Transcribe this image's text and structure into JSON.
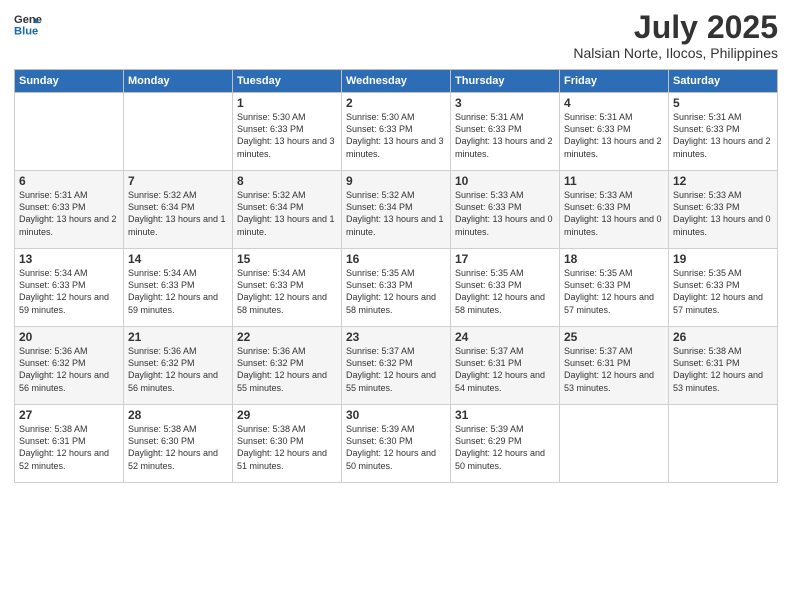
{
  "header": {
    "logo_line1": "General",
    "logo_line2": "Blue",
    "month": "July 2025",
    "location": "Nalsian Norte, Ilocos, Philippines"
  },
  "weekdays": [
    "Sunday",
    "Monday",
    "Tuesday",
    "Wednesday",
    "Thursday",
    "Friday",
    "Saturday"
  ],
  "weeks": [
    [
      {
        "day": "",
        "info": ""
      },
      {
        "day": "",
        "info": ""
      },
      {
        "day": "1",
        "info": "Sunrise: 5:30 AM\nSunset: 6:33 PM\nDaylight: 13 hours\nand 3 minutes."
      },
      {
        "day": "2",
        "info": "Sunrise: 5:30 AM\nSunset: 6:33 PM\nDaylight: 13 hours\nand 3 minutes."
      },
      {
        "day": "3",
        "info": "Sunrise: 5:31 AM\nSunset: 6:33 PM\nDaylight: 13 hours\nand 2 minutes."
      },
      {
        "day": "4",
        "info": "Sunrise: 5:31 AM\nSunset: 6:33 PM\nDaylight: 13 hours\nand 2 minutes."
      },
      {
        "day": "5",
        "info": "Sunrise: 5:31 AM\nSunset: 6:33 PM\nDaylight: 13 hours\nand 2 minutes."
      }
    ],
    [
      {
        "day": "6",
        "info": "Sunrise: 5:31 AM\nSunset: 6:33 PM\nDaylight: 13 hours\nand 2 minutes."
      },
      {
        "day": "7",
        "info": "Sunrise: 5:32 AM\nSunset: 6:34 PM\nDaylight: 13 hours\nand 1 minute."
      },
      {
        "day": "8",
        "info": "Sunrise: 5:32 AM\nSunset: 6:34 PM\nDaylight: 13 hours\nand 1 minute."
      },
      {
        "day": "9",
        "info": "Sunrise: 5:32 AM\nSunset: 6:34 PM\nDaylight: 13 hours\nand 1 minute."
      },
      {
        "day": "10",
        "info": "Sunrise: 5:33 AM\nSunset: 6:33 PM\nDaylight: 13 hours\nand 0 minutes."
      },
      {
        "day": "11",
        "info": "Sunrise: 5:33 AM\nSunset: 6:33 PM\nDaylight: 13 hours\nand 0 minutes."
      },
      {
        "day": "12",
        "info": "Sunrise: 5:33 AM\nSunset: 6:33 PM\nDaylight: 13 hours\nand 0 minutes."
      }
    ],
    [
      {
        "day": "13",
        "info": "Sunrise: 5:34 AM\nSunset: 6:33 PM\nDaylight: 12 hours\nand 59 minutes."
      },
      {
        "day": "14",
        "info": "Sunrise: 5:34 AM\nSunset: 6:33 PM\nDaylight: 12 hours\nand 59 minutes."
      },
      {
        "day": "15",
        "info": "Sunrise: 5:34 AM\nSunset: 6:33 PM\nDaylight: 12 hours\nand 58 minutes."
      },
      {
        "day": "16",
        "info": "Sunrise: 5:35 AM\nSunset: 6:33 PM\nDaylight: 12 hours\nand 58 minutes."
      },
      {
        "day": "17",
        "info": "Sunrise: 5:35 AM\nSunset: 6:33 PM\nDaylight: 12 hours\nand 58 minutes."
      },
      {
        "day": "18",
        "info": "Sunrise: 5:35 AM\nSunset: 6:33 PM\nDaylight: 12 hours\nand 57 minutes."
      },
      {
        "day": "19",
        "info": "Sunrise: 5:35 AM\nSunset: 6:33 PM\nDaylight: 12 hours\nand 57 minutes."
      }
    ],
    [
      {
        "day": "20",
        "info": "Sunrise: 5:36 AM\nSunset: 6:32 PM\nDaylight: 12 hours\nand 56 minutes."
      },
      {
        "day": "21",
        "info": "Sunrise: 5:36 AM\nSunset: 6:32 PM\nDaylight: 12 hours\nand 56 minutes."
      },
      {
        "day": "22",
        "info": "Sunrise: 5:36 AM\nSunset: 6:32 PM\nDaylight: 12 hours\nand 55 minutes."
      },
      {
        "day": "23",
        "info": "Sunrise: 5:37 AM\nSunset: 6:32 PM\nDaylight: 12 hours\nand 55 minutes."
      },
      {
        "day": "24",
        "info": "Sunrise: 5:37 AM\nSunset: 6:31 PM\nDaylight: 12 hours\nand 54 minutes."
      },
      {
        "day": "25",
        "info": "Sunrise: 5:37 AM\nSunset: 6:31 PM\nDaylight: 12 hours\nand 53 minutes."
      },
      {
        "day": "26",
        "info": "Sunrise: 5:38 AM\nSunset: 6:31 PM\nDaylight: 12 hours\nand 53 minutes."
      }
    ],
    [
      {
        "day": "27",
        "info": "Sunrise: 5:38 AM\nSunset: 6:31 PM\nDaylight: 12 hours\nand 52 minutes."
      },
      {
        "day": "28",
        "info": "Sunrise: 5:38 AM\nSunset: 6:30 PM\nDaylight: 12 hours\nand 52 minutes."
      },
      {
        "day": "29",
        "info": "Sunrise: 5:38 AM\nSunset: 6:30 PM\nDaylight: 12 hours\nand 51 minutes."
      },
      {
        "day": "30",
        "info": "Sunrise: 5:39 AM\nSunset: 6:30 PM\nDaylight: 12 hours\nand 50 minutes."
      },
      {
        "day": "31",
        "info": "Sunrise: 5:39 AM\nSunset: 6:29 PM\nDaylight: 12 hours\nand 50 minutes."
      },
      {
        "day": "",
        "info": ""
      },
      {
        "day": "",
        "info": ""
      }
    ]
  ]
}
